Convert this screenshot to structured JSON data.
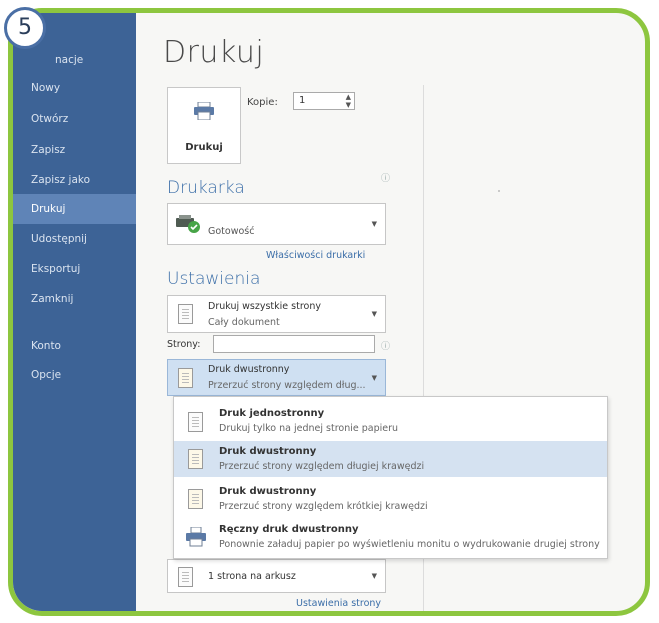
{
  "step_badge": "5",
  "sidebar": {
    "items": [
      {
        "label": "nacje"
      },
      {
        "label": "Nowy"
      },
      {
        "label": "Otwórz"
      },
      {
        "label": "Zapisz"
      },
      {
        "label": "Zapisz jako"
      },
      {
        "label": "Drukuj",
        "active": true
      },
      {
        "label": "Udostępnij"
      },
      {
        "label": "Eksportuj"
      },
      {
        "label": "Zamknij"
      },
      {
        "label": "Konto"
      },
      {
        "label": "Opcje"
      }
    ]
  },
  "main": {
    "title": "Drukuj",
    "print_button_label": "Drukuj",
    "copies_label": "Kopie:",
    "copies_value": "1",
    "printer_section": "Drukarka",
    "printer_status": "Gotowość",
    "printer_properties_link": "Właściwości drukarki",
    "settings_section": "Ustawienia",
    "print_range": {
      "title": "Drukuj wszystkie strony",
      "subtitle": "Cały dokument"
    },
    "pages_label": "Strony:",
    "pages_value": "",
    "duplex": {
      "title": "Druk dwustronny",
      "subtitle": "Przerzuć strony względem dług..."
    },
    "per_sheet": "1 strona na arkusz",
    "page_setup_link": "Ustawienia strony"
  },
  "duplex_menu": [
    {
      "title": "Druk jednostronny",
      "subtitle": "Drukuj tylko na jednej stronie papieru",
      "selected": false
    },
    {
      "title": "Druk dwustronny",
      "subtitle": "Przerzuć strony względem długiej krawędzi",
      "selected": true
    },
    {
      "title": "Druk dwustronny",
      "subtitle": "Przerzuć strony względem krótkiej krawędzi",
      "selected": false
    },
    {
      "title": "Ręczny druk dwustronny",
      "subtitle": "Ponownie załaduj papier po wyświetleniu monitu o wydrukowanie drugiej strony",
      "selected": false
    }
  ],
  "colors": {
    "sidebar": "#3d6396",
    "active": "#5f84b7",
    "accent": "#3b6ea8",
    "frame": "#8dc63f",
    "menu_selected": "#d5e2f1"
  }
}
